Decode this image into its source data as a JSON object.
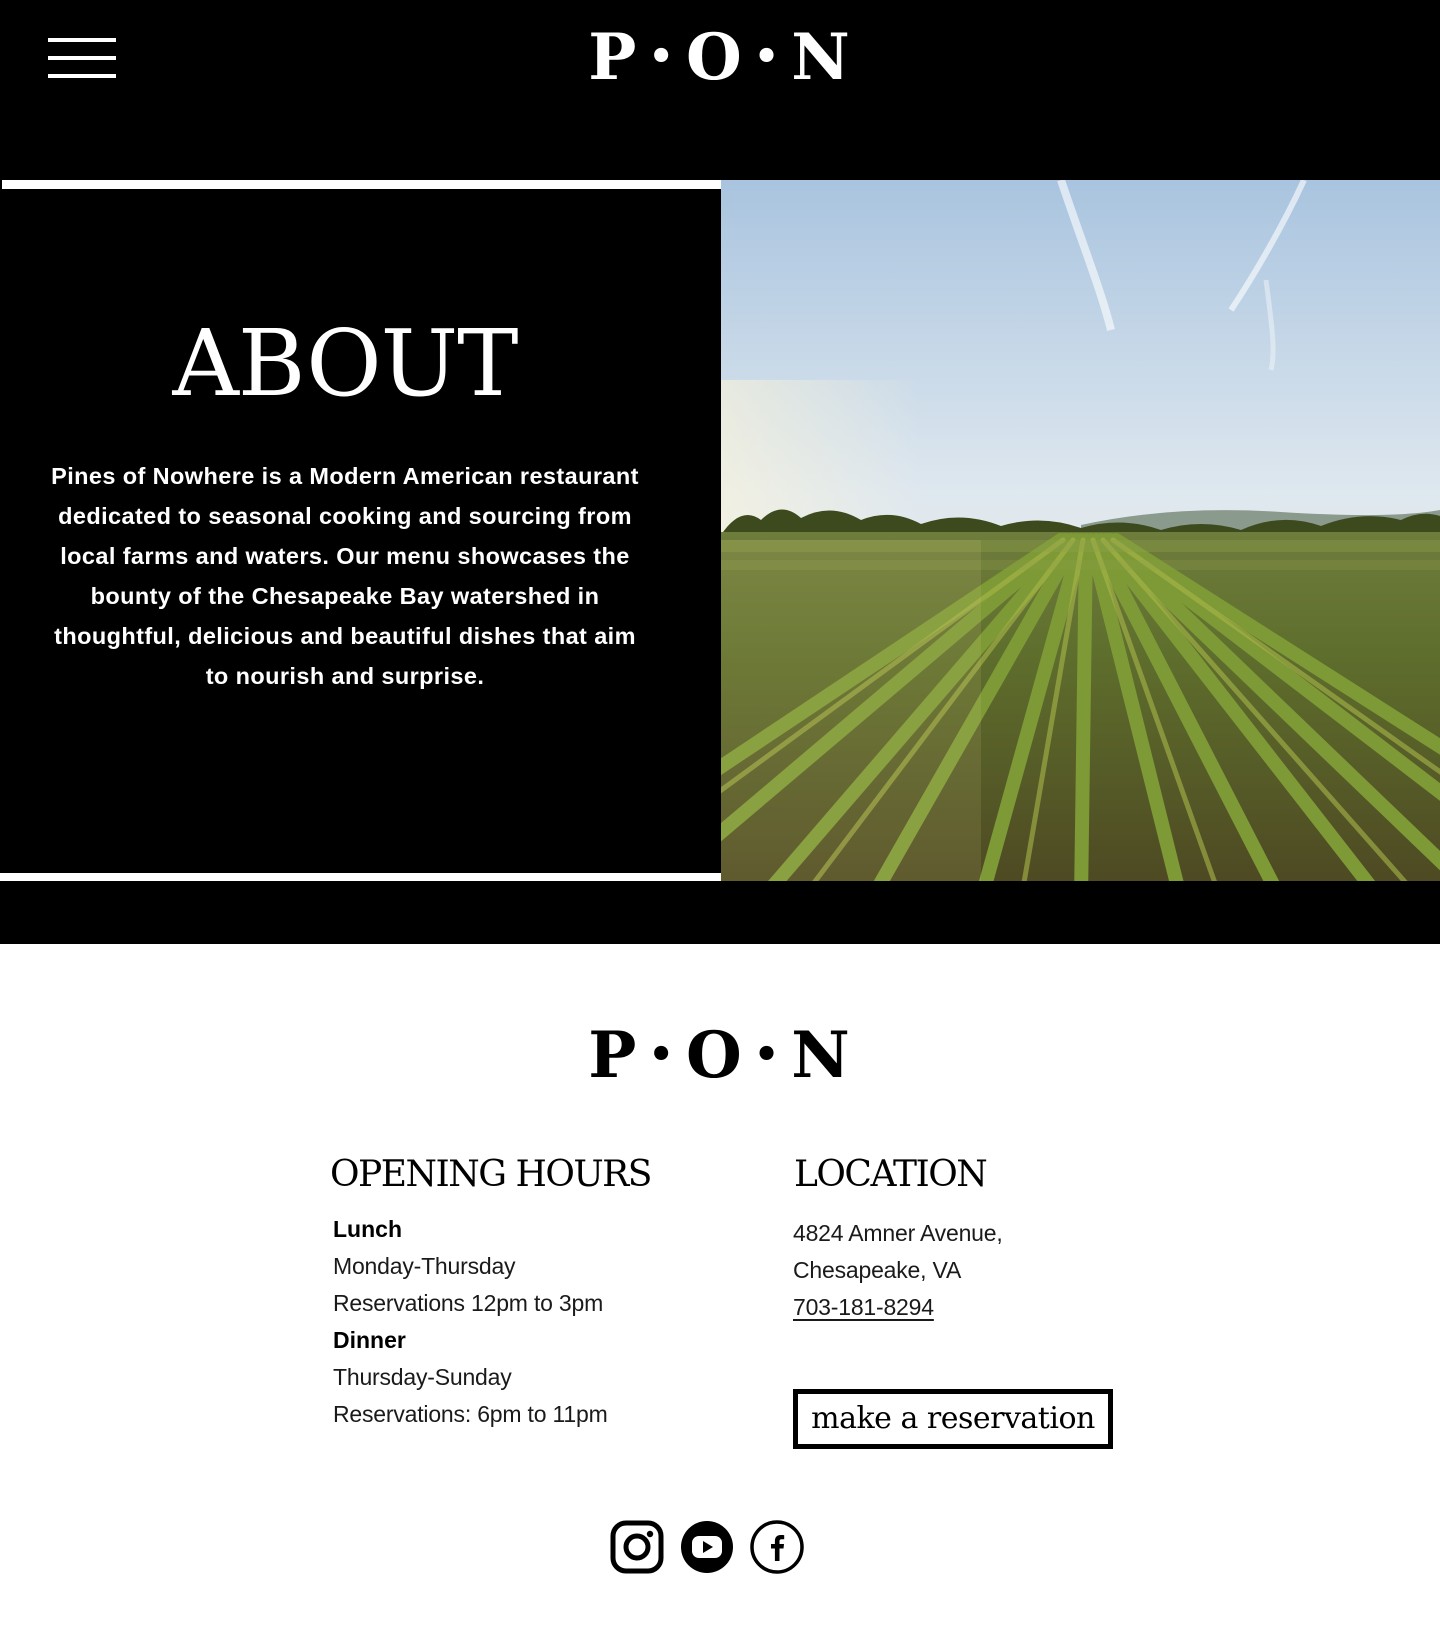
{
  "header": {
    "logo": {
      "p": "P",
      "dot": "•",
      "o": "O",
      "n": "N"
    },
    "menu_icon": "hamburger-menu-icon"
  },
  "about": {
    "title": "ABOUT",
    "text": "Pines of Nowhere is a Modern American restaurant dedicated to seasonal cooking and sourcing from local farms and waters.  Our menu showcases the bounty of the Chesapeake Bay watershed in thoughtful, delicious and beautiful dishes that aim to nourish and surprise.",
    "image_icon": "farm-field-photo"
  },
  "footer": {
    "logo": {
      "p": "P",
      "dot": "•",
      "o": "O",
      "n": "N"
    },
    "hours": {
      "heading": "OPENING HOURS",
      "lunch_label": "Lunch",
      "lunch_days": "Monday-Thursday",
      "lunch_times": "Reservations 12pm to 3pm",
      "dinner_label": "Dinner",
      "dinner_days": "Thursday-Sunday",
      "dinner_times": "Reservations: 6pm to 11pm"
    },
    "location": {
      "heading": "LOCATION",
      "address_line1": "4824 Amner Avenue,",
      "address_line2": "Chesapeake, VA",
      "phone": "703-181-8294"
    },
    "reservation_button": "make a reservation",
    "social": [
      {
        "icon": "instagram-icon"
      },
      {
        "icon": "youtube-icon"
      },
      {
        "icon": "facebook-icon"
      }
    ]
  },
  "colors": {
    "background_dark": "#000000",
    "background_light": "#ffffff",
    "text_light": "#ffffff",
    "text_dark": "#000000"
  }
}
